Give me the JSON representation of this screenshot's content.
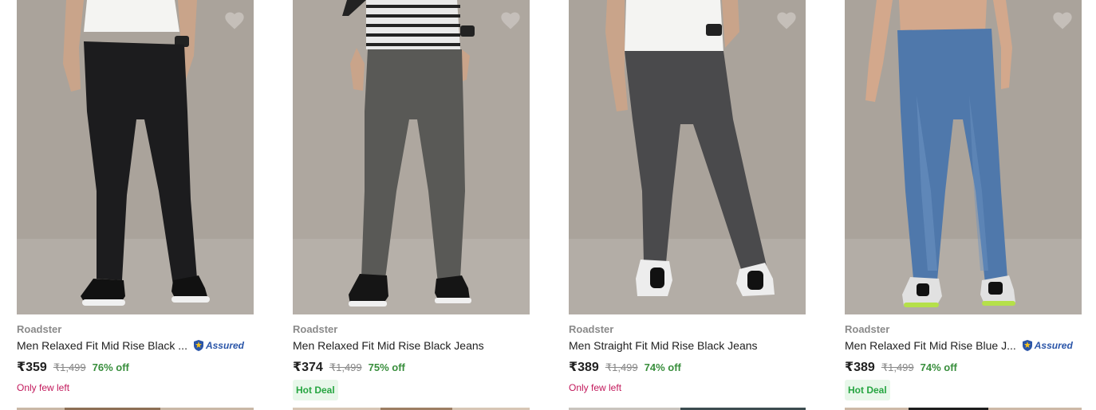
{
  "colors": {
    "brand_text": "#8a8a8a",
    "price": "#212121",
    "mrp": "#878787",
    "discount": "#388e3c",
    "only_few_left": "#c2185b",
    "hot_deal_text": "#26a541",
    "hot_deal_bg": "#e8f7ea",
    "assured_blue": "#2a55a8",
    "wishlist_heart": "#c8c2bd"
  },
  "products": [
    {
      "brand": "Roadster",
      "title": "Men Relaxed Fit Mid Rise Black ...",
      "assured_label": "Assured",
      "price": "₹359",
      "mrp": "₹1,499",
      "discount": "76% off",
      "tag": "Only few left",
      "image_icon": "product-photo-black-jeans"
    },
    {
      "brand": "Roadster",
      "title": "Men Relaxed Fit Mid Rise Black Jeans",
      "price": "₹374",
      "mrp": "₹1,499",
      "discount": "75% off",
      "tag": "Hot Deal",
      "image_icon": "product-photo-grey-jeans"
    },
    {
      "brand": "Roadster",
      "title": "Men Straight Fit Mid Rise Black Jeans",
      "price": "₹389",
      "mrp": "₹1,499",
      "discount": "74% off",
      "tag": "Only few left",
      "image_icon": "product-photo-charcoal-jeans"
    },
    {
      "brand": "Roadster",
      "title": "Men Relaxed Fit Mid Rise Blue J...",
      "assured_label": "Assured",
      "price": "₹389",
      "mrp": "₹1,499",
      "discount": "74% off",
      "tag": "Hot Deal",
      "image_icon": "product-photo-blue-jeans"
    }
  ]
}
